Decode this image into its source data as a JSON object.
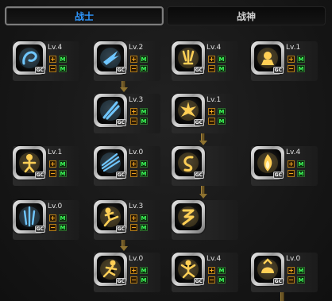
{
  "tabs": [
    {
      "label": "战士",
      "active": true
    },
    {
      "label": "战神",
      "active": false
    }
  ],
  "colors": {
    "active_tab_text": "#2e97ff",
    "inactive_tab_text": "#cfcfcf",
    "plus_minus": "#ffb020",
    "m_button": "#3dff5a",
    "icon_blue": "#6fc6ff",
    "icon_gold": "#ffcf55"
  },
  "buttons": {
    "plus": "+",
    "minus": "−",
    "m": "M"
  },
  "skills": [
    {
      "id": "s1",
      "level": "Lv.4",
      "badge": "GC",
      "icon": "blue-ring-skill-icon",
      "glow": "blue"
    },
    {
      "id": "s2",
      "level": "Lv.2",
      "badge": "GC",
      "icon": "blue-wing-skill-icon",
      "glow": "blue"
    },
    {
      "id": "s3",
      "level": "Lv.4",
      "badge": "GC",
      "icon": "gold-claw-skill-icon",
      "glow": "gold"
    },
    {
      "id": "s4",
      "level": "Lv.1",
      "badge": "GC",
      "icon": "gold-fist-skill-icon",
      "glow": "gold"
    },
    {
      "id": "s5",
      "level": "Lv.3",
      "badge": "GC",
      "icon": "blue-slash-skill-icon",
      "glow": "blue"
    },
    {
      "id": "s6",
      "level": "Lv.1",
      "badge": "GC",
      "icon": "gold-burst-skill-icon",
      "glow": "gold"
    },
    {
      "id": "s7",
      "level": "Lv.1",
      "badge": "GC",
      "icon": "gold-figure-skill-icon",
      "glow": "gold"
    },
    {
      "id": "s8",
      "level": "Lv.0",
      "badge": "GC",
      "icon": "blue-spikes-skill-icon",
      "glow": "blue"
    },
    {
      "id": "s9",
      "level": "",
      "badge": "GC",
      "icon": "gold-swirl-skill-icon",
      "glow": "gold"
    },
    {
      "id": "s10",
      "level": "Lv.4",
      "badge": "GC",
      "icon": "gold-flame-skill-icon",
      "glow": "gold"
    },
    {
      "id": "s11",
      "level": "Lv.0",
      "badge": "GC",
      "icon": "blue-storm-skill-icon",
      "glow": "blue"
    },
    {
      "id": "s12",
      "level": "Lv.3",
      "badge": "GC",
      "icon": "gold-kick-skill-icon",
      "glow": "gold"
    },
    {
      "id": "s13",
      "level": "",
      "badge": "",
      "icon": "gold-rune-skill-icon",
      "glow": "gold"
    },
    {
      "id": "s14",
      "level": "Lv.0",
      "badge": "GC",
      "icon": "gold-leap-skill-icon",
      "glow": "gold"
    },
    {
      "id": "s15",
      "level": "Lv.4",
      "badge": "GC",
      "icon": "gold-dancer-skill-icon",
      "glow": "gold"
    },
    {
      "id": "s16",
      "level": "Lv.0",
      "badge": "GC",
      "icon": "gold-helm-skill-icon",
      "glow": "gold"
    }
  ]
}
